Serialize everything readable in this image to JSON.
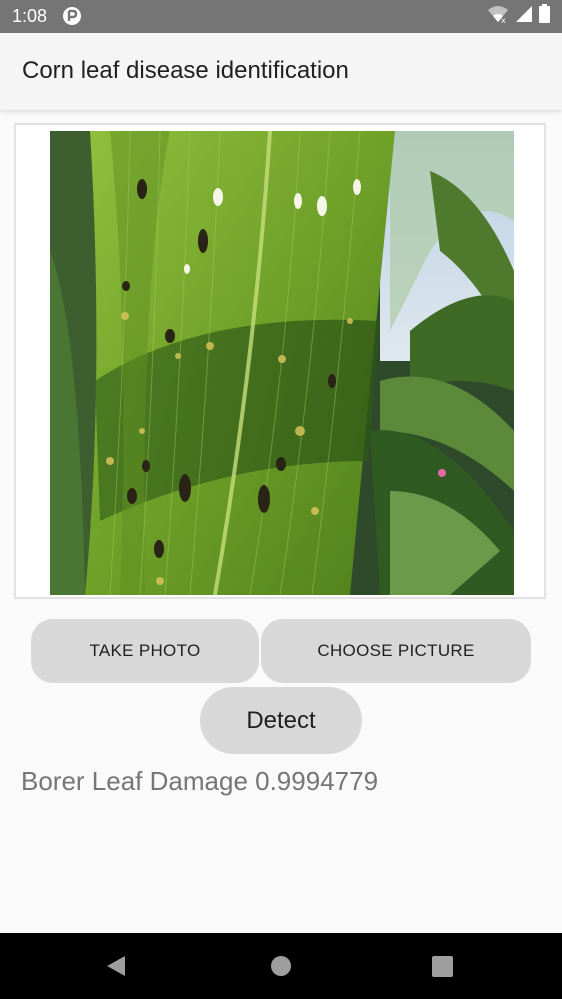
{
  "status_bar": {
    "time": "1:08",
    "icons": [
      "app-notification-icon",
      "wifi-icon",
      "cell-signal-icon",
      "battery-icon"
    ]
  },
  "app_bar": {
    "title": "Corn leaf disease identification"
  },
  "image_preview": {
    "icon": "leaf-photo"
  },
  "buttons": {
    "take_photo": "TAKE PHOTO",
    "choose_picture": "CHOOSE PICTURE",
    "detect": "Detect"
  },
  "result": {
    "text": "Borer Leaf Damage 0.9994779"
  },
  "nav_bar": {
    "icons": [
      "back-icon",
      "home-icon",
      "recents-icon"
    ]
  },
  "colors": {
    "status_bar": "#757575",
    "app_bar": "#f5f5f5",
    "background": "#fafafa",
    "button": "#d8d8d8",
    "result_text": "#767676",
    "nav_bar": "#000000"
  }
}
